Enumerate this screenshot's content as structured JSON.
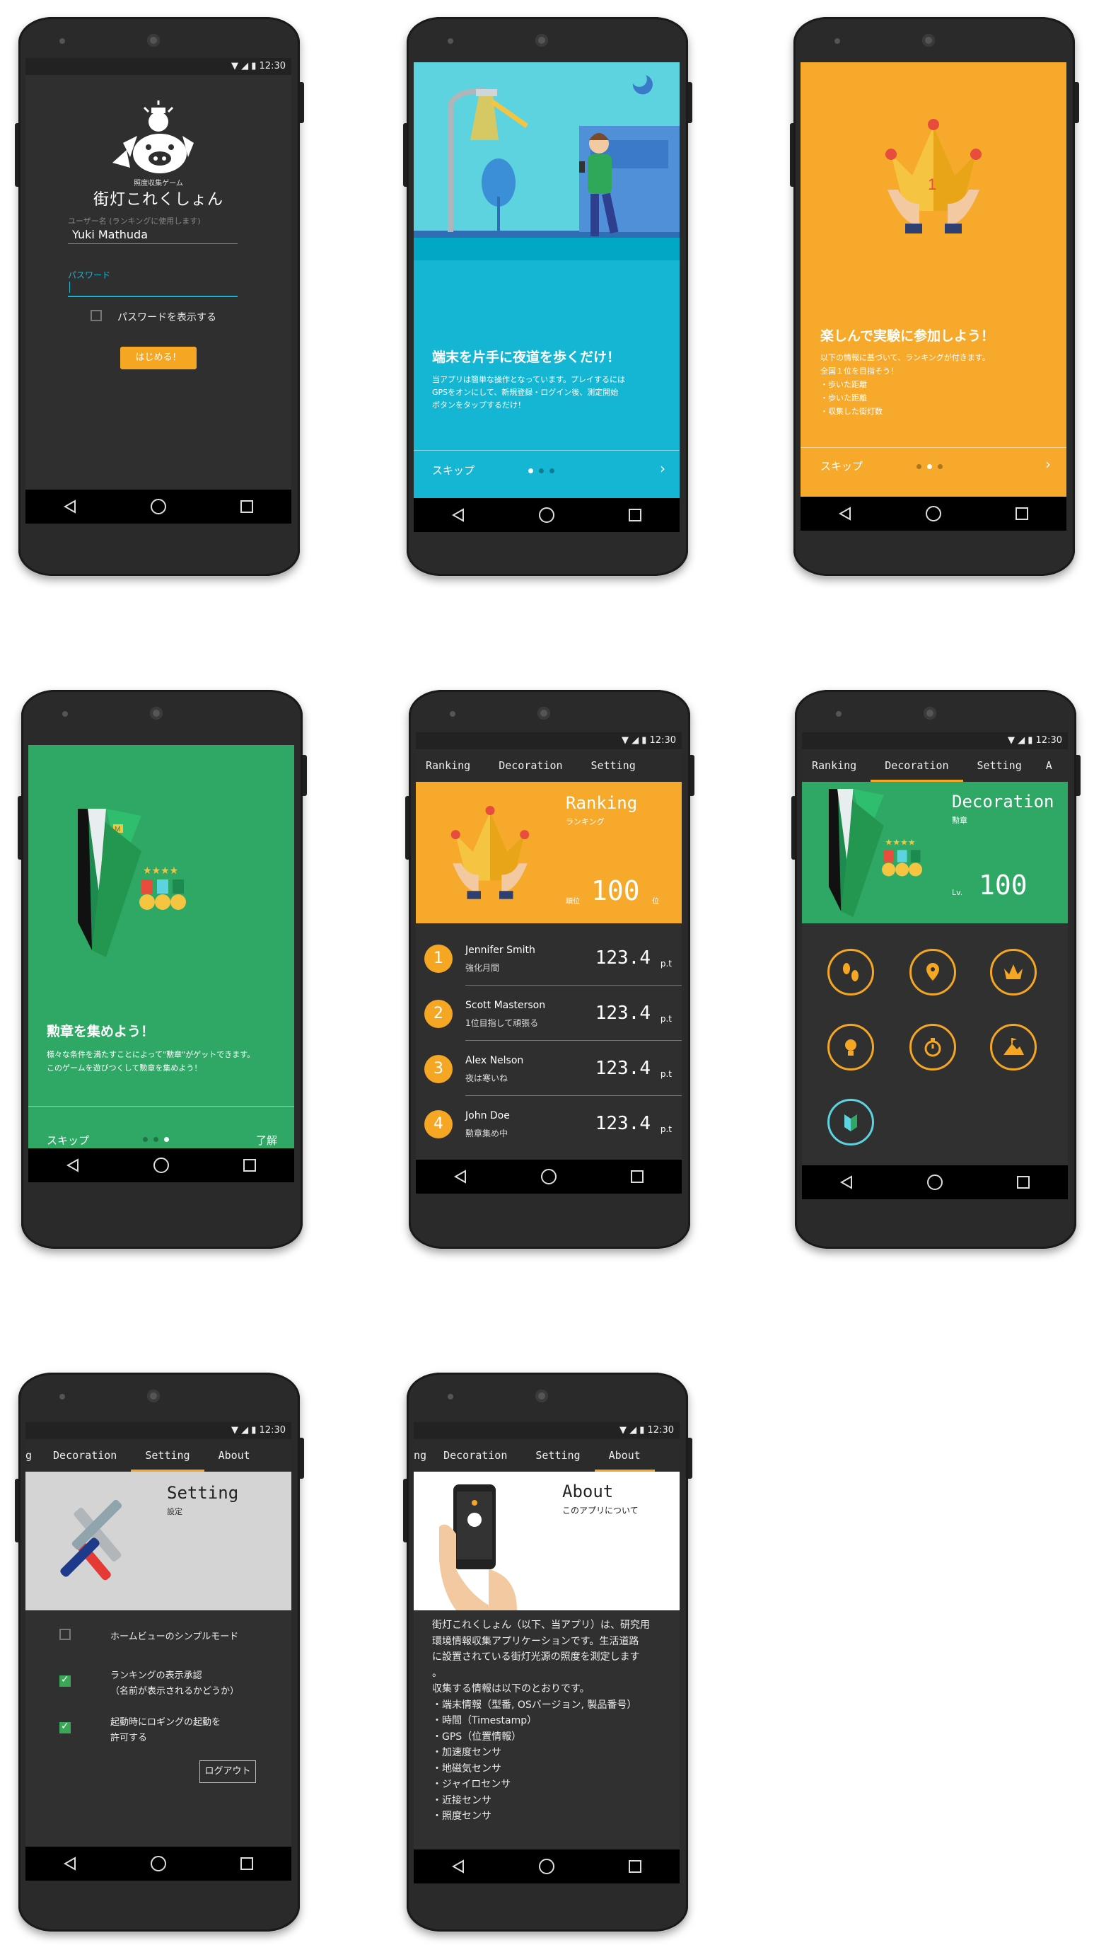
{
  "status_time": "12:30",
  "login": {
    "app_subtitle": "照度収集ゲーム",
    "app_title": "街灯これくしょん",
    "username_label": "ユーザー名 (ランキングに使用します)",
    "username_value": "Yuki Mathuda",
    "password_label": "パスワード",
    "show_password_label": "パスワードを表示する",
    "start_button": "はじめる！"
  },
  "intro1": {
    "heading": "端末を片手に夜道を歩くだけ！",
    "body": "当アプリは簡単な操作となっています。プレイするには\nGPSをオンにして、新規登録・ログイン後、測定開始\nボタンをタップするだけ！",
    "skip": "スキップ",
    "next_icon": "chevron-right-icon"
  },
  "intro2": {
    "heading": "楽しんで実験に参加しよう！",
    "body": "以下の情報に基づいて、ランキングが付きます。\n全国１位を目指そう！\n・歩いた距離\n・歩いた距離\n・収集した街灯数",
    "skip": "スキップ"
  },
  "intro3": {
    "heading": "勲章を集めよう！",
    "body": "様々な条件を満たすことによって\"勲章\"がゲットできます。\nこのゲームを遊びつくして勲章を集めよう！",
    "skip": "スキップ",
    "done": "了解"
  },
  "tabs": {
    "ranking": "Ranking",
    "decoration": "Decoration",
    "setting": "Setting",
    "about": "About",
    "partial_a": "A",
    "partial_g": "g",
    "partial_ng": "ng"
  },
  "ranking": {
    "title": "Ranking",
    "subtitle": "ランキング",
    "prefix": "順位",
    "value": "100",
    "suffix": "位",
    "rows": [
      {
        "rank": "1",
        "name": "Jennifer Smith",
        "sub": "強化月間",
        "score": "123.4",
        "unit": "p.t"
      },
      {
        "rank": "2",
        "name": "Scott Masterson",
        "sub": "1位目指して頑張る",
        "score": "123.4",
        "unit": "p.t"
      },
      {
        "rank": "3",
        "name": "Alex Nelson",
        "sub": "夜は寒いね",
        "score": "123.4",
        "unit": "p.t"
      },
      {
        "rank": "4",
        "name": "John Doe",
        "sub": "勲章集め中",
        "score": "123.4",
        "unit": "p.t"
      }
    ]
  },
  "decoration": {
    "title": "Decoration",
    "subtitle": "勲章",
    "lv_label": "Lv.",
    "lv_value": "100",
    "badges": [
      "footprints-icon",
      "map-pin-icon",
      "crown-icon",
      "lightbulb-icon",
      "stopwatch-icon",
      "mountain-flag-icon",
      "beginner-mark-icon"
    ]
  },
  "setting": {
    "title": "Setting",
    "subtitle": "設定",
    "options": [
      {
        "label": "ホームビューのシンプルモード",
        "checked": false
      },
      {
        "label": "ランキングの表示承認\n（名前が表示されるかどうか）",
        "checked": true
      },
      {
        "label": "起動時にロギングの起動を\n許可する",
        "checked": true
      }
    ],
    "logout": "ログアウト"
  },
  "about": {
    "title": "About",
    "subtitle": "このアプリについて",
    "body_lines": [
      "街灯これくしょん（以下、当アプリ）は、研究用",
      "環境情報収集アプリケーションです。生活道路",
      "に設置されている街灯光源の照度を測定します",
      "。",
      "収集する情報は以下のとおりです。",
      "・端末情報（型番, OSバージョン, 製品番号）",
      "・時間（Timestamp）",
      "・GPS（位置情報）",
      "・加速度センサ",
      "・地磁気センサ",
      "・ジャイロセンサ",
      "・近接センサ",
      "・照度センサ"
    ]
  },
  "colors": {
    "orange": "#f5a623",
    "green": "#2fa866",
    "cyan": "#15b6d3",
    "dark": "#303030"
  }
}
